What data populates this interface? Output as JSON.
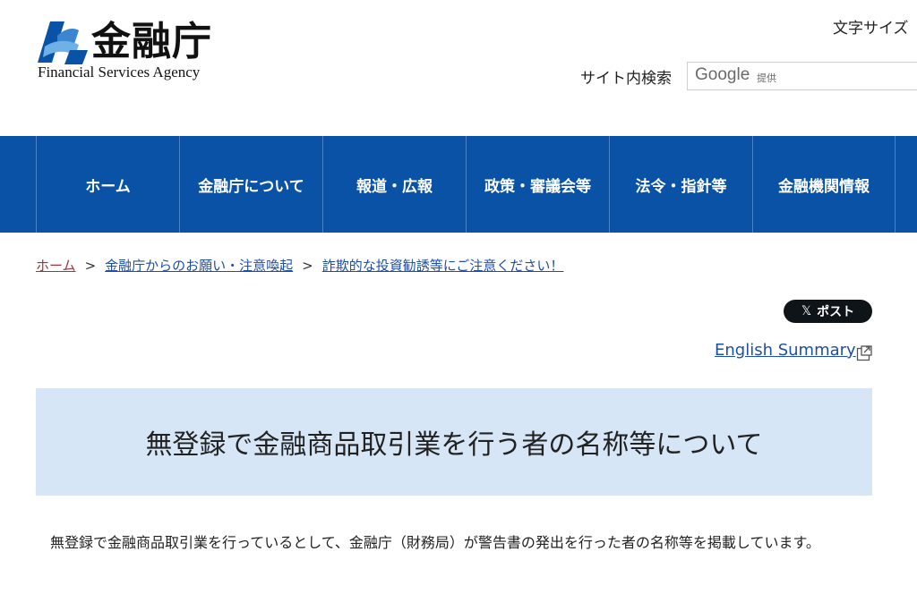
{
  "header": {
    "logo_kanji": "金融庁",
    "logo_english": "Financial Services Agency",
    "font_size_label": "文字サイズ",
    "search_label": "サイト内検索",
    "search_google": "Google",
    "search_provided": "提供"
  },
  "nav": {
    "items": [
      {
        "label": "ホーム"
      },
      {
        "label": "金融庁について"
      },
      {
        "label": "報道・広報"
      },
      {
        "label": "政策・審議会等"
      },
      {
        "label": "法令・指針等"
      },
      {
        "label": "金融機関情報"
      }
    ]
  },
  "breadcrumb": {
    "home": "ホーム",
    "level1": "金融庁からのお願い・注意喚起",
    "level2": "詐欺的な投資勧誘等にご注意ください！",
    "separator": ">"
  },
  "social": {
    "post_label": "ポスト",
    "x_symbol": "𝕏"
  },
  "english_summary": "English Summary",
  "title": "無登録で金融商品取引業を行う者の名称等について",
  "body": "無登録で金融商品取引業を行っているとして、金融庁（財務局）が警告書の発出を行った者の名称等を掲載しています。",
  "colors": {
    "nav_bg": "#0a52a6",
    "title_bg": "#d6e6f6",
    "link": "#1d4fa8",
    "home_link": "#a0343d"
  }
}
